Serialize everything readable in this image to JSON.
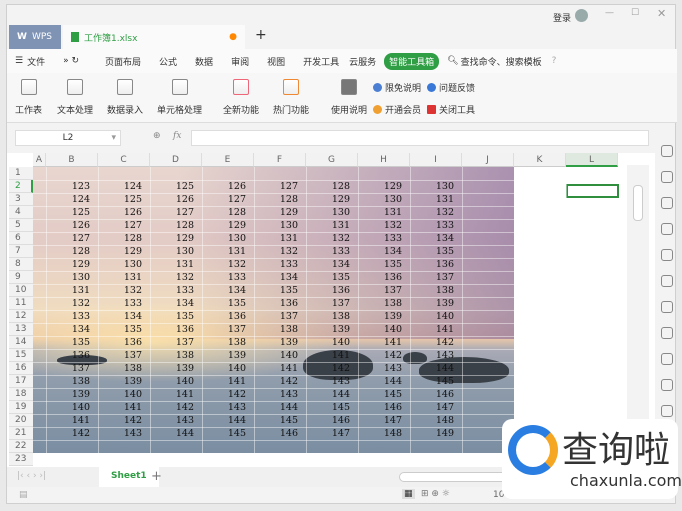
{
  "titlebar": {
    "login": "登录",
    "app_tab": "WPS",
    "doc_tab": "工作簿1.xlsx"
  },
  "menu": {
    "file": "文件",
    "items": [
      "页面布局",
      "公式",
      "数据",
      "审阅",
      "视图",
      "开发工具",
      "云服务"
    ],
    "active": "智能工具箱",
    "search": "查找命令、搜索模板",
    "help": "?"
  },
  "ribbon": {
    "buttons": [
      "工作表",
      "文本处理",
      "数据录入",
      "单元格处理",
      "全新功能",
      "热门功能",
      "使用说明"
    ],
    "links": [
      "限免说明",
      "问题反馈",
      "开通会员",
      "关闭工具"
    ]
  },
  "formula": {
    "name_box": "L2",
    "fx": "fx",
    "value": ""
  },
  "columns": [
    "A",
    "B",
    "C",
    "D",
    "E",
    "F",
    "G",
    "H",
    "I",
    "J",
    "K",
    "L"
  ],
  "rows": [
    "1",
    "2",
    "3",
    "4",
    "5",
    "6",
    "7",
    "8",
    "9",
    "10",
    "11",
    "12",
    "13",
    "14",
    "15",
    "16",
    "17",
    "18",
    "19",
    "20",
    "21",
    "22",
    "23"
  ],
  "cells": [
    [
      123,
      124,
      125,
      126,
      127,
      128,
      129,
      130
    ],
    [
      124,
      125,
      126,
      127,
      128,
      129,
      130,
      131
    ],
    [
      125,
      126,
      127,
      128,
      129,
      130,
      131,
      132
    ],
    [
      126,
      127,
      128,
      129,
      130,
      131,
      132,
      133
    ],
    [
      127,
      128,
      129,
      130,
      131,
      132,
      133,
      134
    ],
    [
      128,
      129,
      130,
      131,
      132,
      133,
      134,
      135
    ],
    [
      129,
      130,
      131,
      132,
      133,
      134,
      135,
      136
    ],
    [
      130,
      131,
      132,
      133,
      134,
      135,
      136,
      137
    ],
    [
      131,
      132,
      133,
      134,
      135,
      136,
      137,
      138
    ],
    [
      132,
      133,
      134,
      135,
      136,
      137,
      138,
      139
    ],
    [
      133,
      134,
      135,
      136,
      137,
      138,
      139,
      140
    ],
    [
      134,
      135,
      136,
      137,
      138,
      139,
      140,
      141
    ],
    [
      135,
      136,
      137,
      138,
      139,
      140,
      141,
      142
    ],
    [
      136,
      137,
      138,
      139,
      140,
      141,
      142,
      143
    ],
    [
      137,
      138,
      139,
      140,
      141,
      142,
      143,
      144
    ],
    [
      138,
      139,
      140,
      141,
      142,
      143,
      144,
      145
    ],
    [
      139,
      140,
      141,
      142,
      143,
      144,
      145,
      146
    ],
    [
      140,
      141,
      142,
      143,
      144,
      145,
      146,
      147
    ],
    [
      141,
      142,
      143,
      144,
      145,
      146,
      147,
      148
    ],
    [
      142,
      143,
      144,
      145,
      146,
      147,
      148,
      149
    ]
  ],
  "sheet_tab": "Sheet1",
  "status": {
    "zoom": "100%"
  },
  "watermark": {
    "brand": "查询啦",
    "url": "chaxunla.com"
  },
  "colors": {
    "accent": "#2f9e44",
    "wps_tab": "#7f93b5"
  }
}
